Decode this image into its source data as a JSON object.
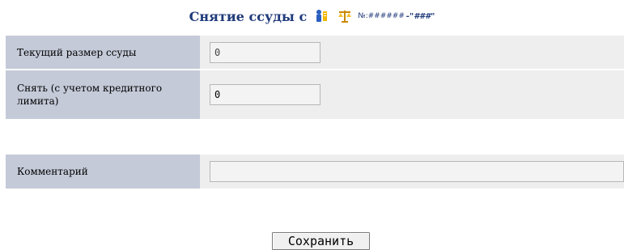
{
  "header": {
    "title": "Снятие ссуды с",
    "account_number": "№:######",
    "account_name": "-\"###\"",
    "icons": [
      "person-info-icon",
      "scales-icon"
    ]
  },
  "form": {
    "current_loan_label": "Текущий размер ссуды",
    "current_loan_value": "0",
    "withdraw_label": "Снять (с учетом кредитного лимита)",
    "withdraw_value": "0",
    "comment_label": "Комментарий",
    "comment_value": ""
  },
  "actions": {
    "save_label": "Сохранить"
  },
  "colors": {
    "label_bg": "#c4cad8",
    "value_bg": "#eeeeee",
    "title": "#1f3a7a"
  }
}
